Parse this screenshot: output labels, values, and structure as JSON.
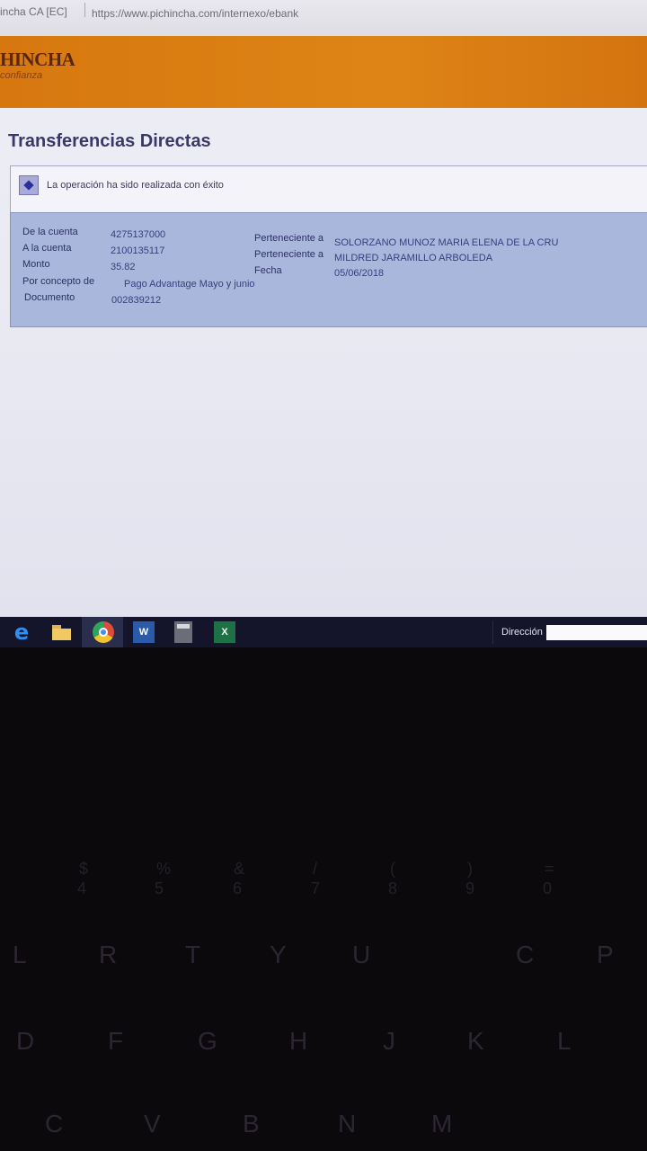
{
  "browser": {
    "site_label": "incha CA [EC]",
    "url": "https://www.pichincha.com/internexo/ebank"
  },
  "brand": {
    "name": "HINCHA",
    "tagline": "confianza"
  },
  "page": {
    "title": "Transferencias Directas",
    "message": "La operación ha sido realizada con éxito"
  },
  "transfer": {
    "left": [
      {
        "label": "De la cuenta",
        "value": "4275137000"
      },
      {
        "label": "A la cuenta",
        "value": "2100135117"
      },
      {
        "label": "Monto",
        "value": "35.82"
      },
      {
        "label": "Por concepto de",
        "value": "Pago Advantage Mayo y junio"
      },
      {
        "label": "Documento",
        "value": "002839212"
      }
    ],
    "right": [
      {
        "label": "Perteneciente a",
        "value": "SOLORZANO MUNOZ MARIA ELENA DE LA CRU"
      },
      {
        "label": "Perteneciente a",
        "value": "MILDRED JARAMILLO ARBOLEDA"
      },
      {
        "label": "Fecha",
        "value": "05/06/2018"
      }
    ]
  },
  "taskbar": {
    "address_label": "Dirección",
    "address_value": "",
    "apps": [
      "edge-icon",
      "file-explorer-icon",
      "chrome-icon",
      "word-icon",
      "calculator-icon",
      "excel-icon"
    ],
    "word_glyph": "W",
    "excel_glyph": "X",
    "edge_glyph": "e"
  },
  "keyboard": {
    "number_row": [
      "4",
      "5",
      "6",
      "7",
      "8",
      "9",
      "0"
    ],
    "number_row_symbols": [
      "$",
      "%",
      "&",
      "/",
      "(",
      ")",
      "="
    ],
    "letter_row_1": [
      "L",
      "R",
      "T",
      "Y",
      "U",
      "C",
      "P"
    ],
    "letter_row_2": [
      "D",
      "F",
      "G",
      "H",
      "J",
      "K",
      "L"
    ],
    "letter_row_3": [
      "C",
      "V",
      "B",
      "N",
      "M"
    ]
  },
  "colors": {
    "brand_orange": "#de8416",
    "title_text": "#3a3868",
    "details_bg": "#aab7dc",
    "taskbar_bg": "#14142a"
  }
}
